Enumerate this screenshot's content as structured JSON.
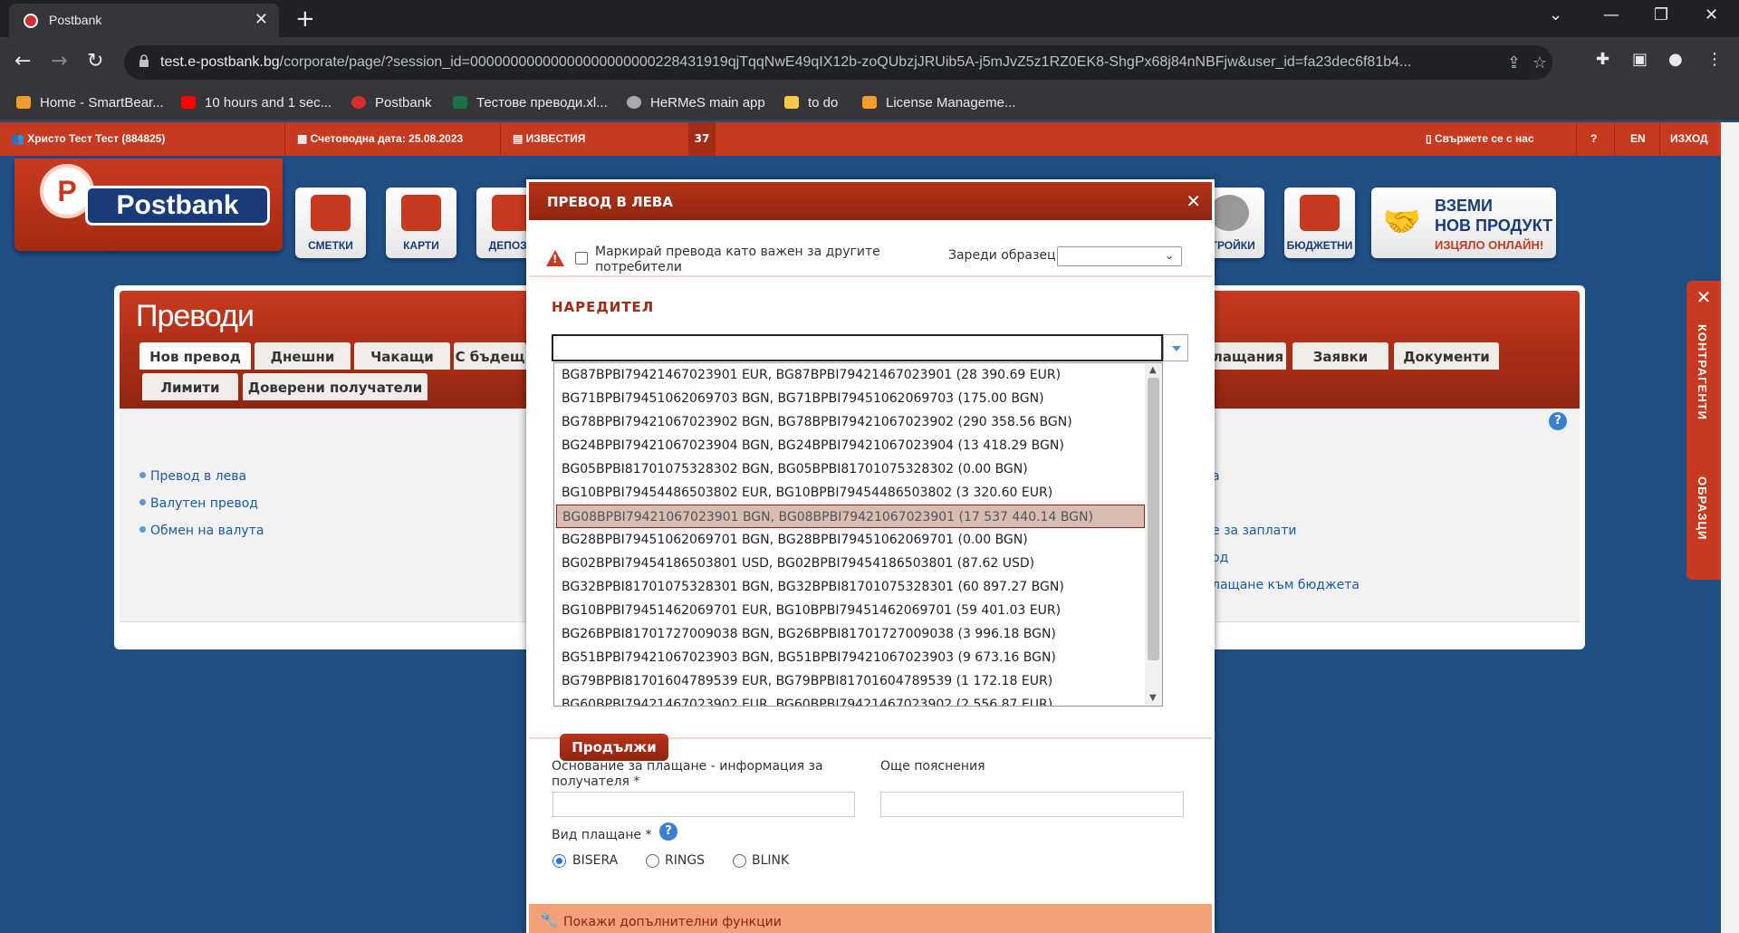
{
  "browser": {
    "tab_title": "Postbank",
    "url_host": "test.e-postbank.bg",
    "url_rest": "/corporate/page/?session_id=00000000000000000000000228431919qjTqqNwE49qIX12b-zoQUbzjJRUib5A-j5mJvZ5z1RZ0EK8-ShgPx68j84nNBFjw&user_id=fa23dec6f81b4...",
    "bookmarks": [
      "Home - SmartBear...",
      "10 hours and 1 sec...",
      "Postbank",
      "Тестове преводи.xl...",
      "HeRMeS main app",
      "to do",
      "License Manageme..."
    ]
  },
  "sitebar": {
    "user": "Христо Тест Тест (884825)",
    "accounting_date": "Счетоводна дата: 25.08.2023",
    "news": "ИЗВЕСТИЯ",
    "news_count": "37",
    "contact": "Свържете се с нас",
    "lang": "EN",
    "logout": "ИЗХОД"
  },
  "header": {
    "logo_text": "Postbank",
    "icons": [
      "СМЕТКИ",
      "КАРТИ",
      "ДЕПОЗИ",
      "СТРОЙКИ",
      "БЮДЖЕТНИ"
    ],
    "promo": {
      "line1": "ВЗЕМИ",
      "line2": "НОВ ПРОДУКТ",
      "line3": "ИЗЦЯЛО ОНЛАЙН!"
    }
  },
  "panel": {
    "title": "Преводи",
    "tabs_row1": [
      "Нов превод",
      "Днешни",
      "Чакащи",
      "С бъдещ"
    ],
    "tabs_row1_right": [
      "лащания",
      "Заявки",
      "Документи"
    ],
    "tabs_row2": [
      "Лимити",
      "Доверени получатели"
    ],
    "links_left": [
      "Превод в лева",
      "Валутен превод",
      "Обмен на валута"
    ],
    "links_right": [
      "а",
      "е за заплати",
      "од",
      "лащане към бюджета"
    ]
  },
  "sidetab": {
    "contacts": "КОНТРАГЕНТИ",
    "templates": "ОБРАЗЦИ"
  },
  "modal": {
    "title": "ПРЕВОД В ЛЕВА",
    "mark_important": "Маркирай превода като важен за другите потребители",
    "load_template": "Зареди образец",
    "payer_section": "НАРЕДИТЕЛ",
    "payer_input_value": "",
    "accounts": [
      "BG87BPBI79421467023901 EUR, BG87BPBI79421467023901 (28 390.69 EUR)",
      "BG71BPBI79451062069703 BGN, BG71BPBI79451062069703 (175.00 BGN)",
      "BG78BPBI79421067023902 BGN, BG78BPBI79421067023902 (290 358.56 BGN)",
      "BG24BPBI79421067023904 BGN, BG24BPBI79421067023904 (13 418.29 BGN)",
      "BG05BPBI81701075328302 BGN, BG05BPBI81701075328302 (0.00 BGN)",
      "BG10BPBI79454486503802 EUR, BG10BPBI79454486503802 (3 320.60 EUR)",
      "BG08BPBI79421067023901 BGN, BG08BPBI79421067023901 (17 537 440.14 BGN)",
      "BG28BPBI79451062069701 BGN, BG28BPBI79451062069701 (0.00 BGN)",
      "BG02BPBI79454186503801 USD, BG02BPBI79454186503801 (87.62 USD)",
      "BG32BPBI81701075328301 BGN, BG32BPBI81701075328301 (60 897.27 BGN)",
      "BG10BPBI79451462069701 EUR, BG10BPBI79451462069701 (59 401.03 EUR)",
      "BG26BPBI81701727009038 BGN, BG26BPBI81701727009038 (3 996.18 BGN)",
      "BG51BPBI79421067023903 BGN, BG51BPBI79421067023903 (9 673.16 BGN)",
      "BG79BPBI81701604789539 EUR, BG79BPBI81701604789539 (1 172.18 EUR)",
      "BG60BPBI79421467023902 EUR, BG60BPBI79421467023902 (2 556.87 EUR)"
    ],
    "selected_index": 6,
    "payment_reason_label": "Основание за плащане - информация за получателя *",
    "more_info_label": "Още пояснения",
    "payment_type_label": "Вид плащане *",
    "payment_types": [
      "BISERA",
      "RINGS",
      "BLINK"
    ],
    "selected_payment_type": "BISERA",
    "show_more": "Покажи допълнителни функции",
    "continue": "Продължи"
  }
}
